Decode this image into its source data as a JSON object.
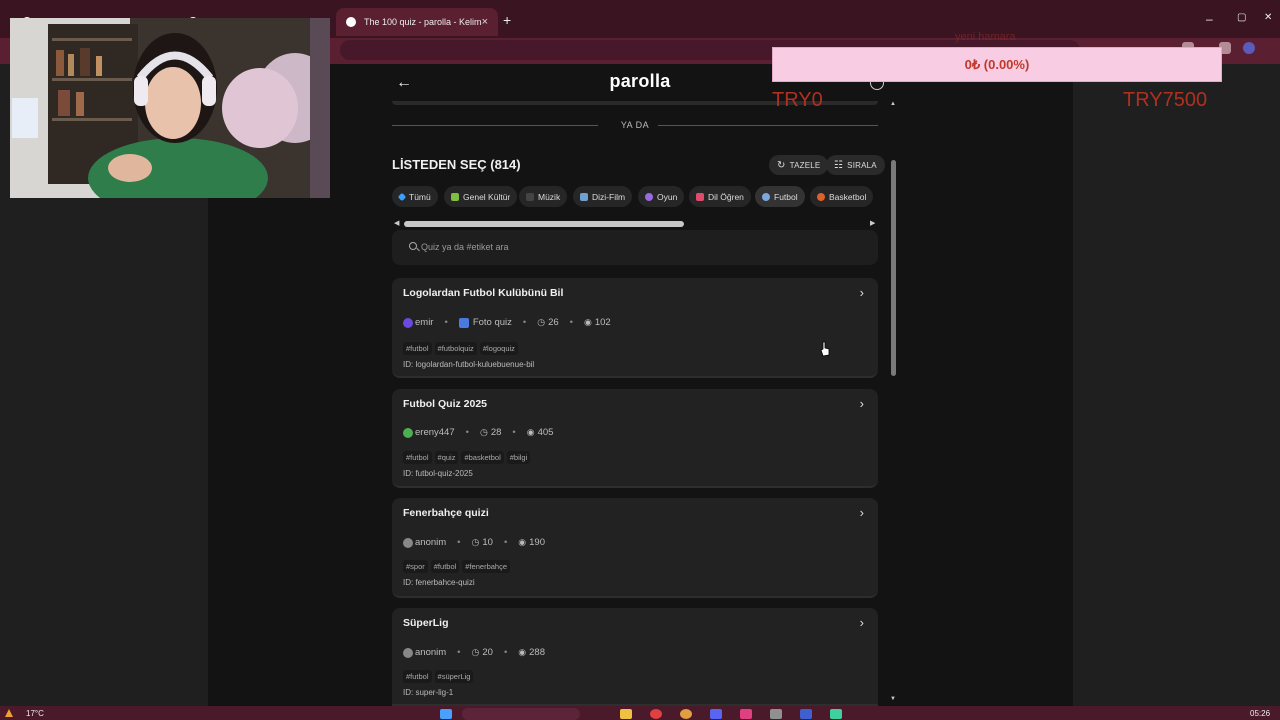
{
  "browser": {
    "tabs": [
      {
        "label": "...",
        "active": false
      },
      {
        "label": "...",
        "active": false
      },
      {
        "label": "The 100 quiz - parolla - Kelime",
        "active": true
      }
    ],
    "new_tab": "+",
    "win_minimize": "–",
    "win_restore": "▢",
    "win_close": "✕"
  },
  "app": {
    "brand": "parolla",
    "divider_text": "YA DA",
    "list_title": "LİSTEDEN SEÇ (814)",
    "refresh_label": "TAZELE",
    "sort_label": "SIRALA",
    "categories": [
      {
        "label": "Tümü",
        "color": "#3aa0ff"
      },
      {
        "label": "Genel Kültür",
        "color": "#7fbf3f"
      },
      {
        "label": "Müzik",
        "color": "#444444"
      },
      {
        "label": "Dizi-Film",
        "color": "#6fa0d0"
      },
      {
        "label": "Oyun",
        "color": "#9a6adf"
      },
      {
        "label": "Dil Öğren",
        "color": "#e04b6b"
      },
      {
        "label": "Futbol",
        "color": "#7ca8e0"
      },
      {
        "label": "Basketbol",
        "color": "#e0602a"
      }
    ],
    "search_placeholder": "Quiz ya da #etiket ara",
    "quizzes": [
      {
        "title": "Logolardan Futbol Kulübünü Bil",
        "author": "emir",
        "author_color": "#6a4adf",
        "type": "Foto quiz",
        "questions": "26",
        "views": "102",
        "tags": [
          "#futbol",
          "#futbolquiz",
          "#logoquiz"
        ],
        "id": "ID: logolardan-futbol-kuluebuenue-bil"
      },
      {
        "title": "Futbol Quiz 2025",
        "author": "ereny447",
        "author_color": "#4caf50",
        "questions": "28",
        "views": "405",
        "tags": [
          "#futbol",
          "#quiz",
          "#basketbol",
          "#bilgi"
        ],
        "id": "ID: futbol-quiz-2025"
      },
      {
        "title": "Fenerbahçe quizi",
        "author": "anonim",
        "author_color": "#888888",
        "questions": "10",
        "views": "190",
        "tags": [
          "#spor",
          "#futbol",
          "#fenerbahçe"
        ],
        "id": "ID: fenerbahce-quizi"
      },
      {
        "title": "SüperLig",
        "author": "anonim",
        "author_color": "#888888",
        "questions": "20",
        "views": "288",
        "tags": [
          "#futbol",
          "#süperLig"
        ],
        "id": "ID: super-lig-1"
      }
    ]
  },
  "overlay": {
    "donation_label": "yeni hamara",
    "donation_amount": "0₺ (0.00%)",
    "goal_start": "TRY0",
    "goal_end": "TRY7500"
  },
  "taskbar": {
    "weather": "17°C",
    "clock": "05:26"
  }
}
